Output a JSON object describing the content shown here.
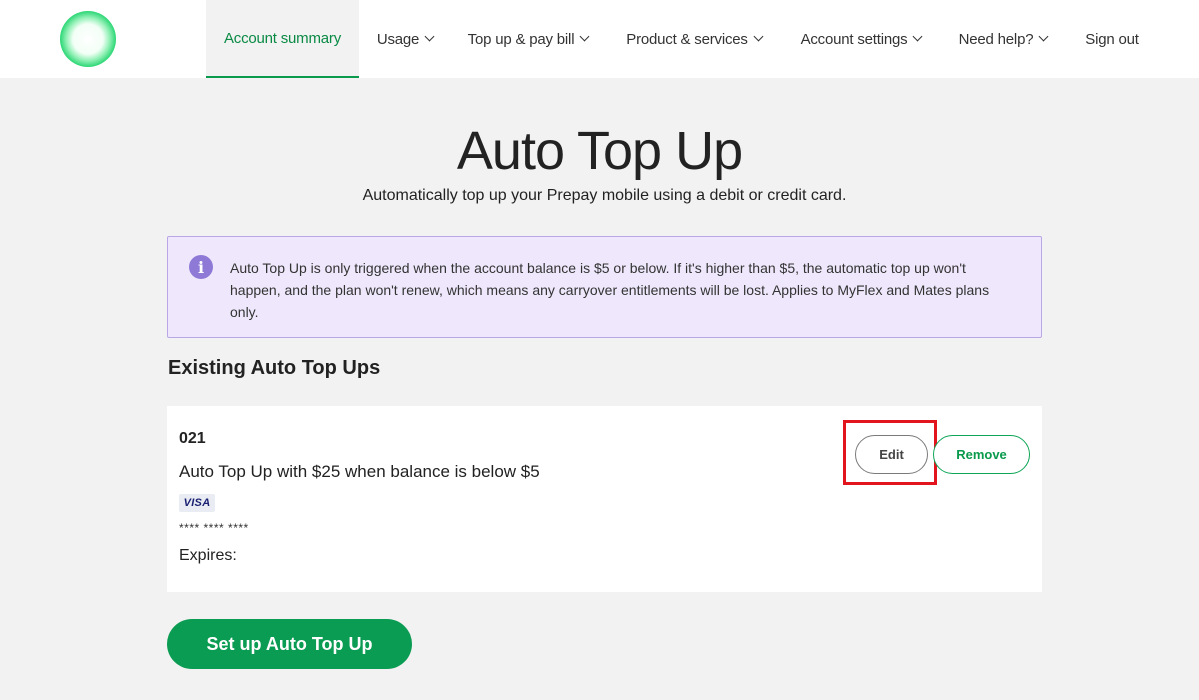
{
  "nav": {
    "account_summary": "Account summary",
    "usage": "Usage",
    "top_up": "Top up & pay bill",
    "products": "Product & services",
    "account_settings": "Account settings",
    "need_help": "Need help?",
    "sign_out": "Sign out"
  },
  "page": {
    "title": "Auto Top Up",
    "subtitle": "Automatically top up your Prepay mobile using a debit or credit card."
  },
  "info": {
    "icon": "info-icon",
    "text": "Auto Top Up is only triggered when the account balance is $5 or below. If it's higher than $5, the automatic top up won't happen, and the plan won't renew, which means any carryover entitlements will be lost. Applies to MyFlex and Mates plans only."
  },
  "existing": {
    "heading": "Existing Auto Top Ups",
    "item": {
      "number": "021",
      "description": "Auto Top Up with $25 when balance is below $5",
      "card_brand": "VISA",
      "masked_card": "**** **** ****",
      "expires_label": "Expires:",
      "edit_label": "Edit",
      "remove_label": "Remove"
    }
  },
  "setup_button": "Set up Auto Top Up",
  "colors": {
    "brand_green": "#0a9c52",
    "highlight_red": "#e2141d",
    "info_bg": "#efe8fc",
    "info_icon": "#8e7ad6"
  }
}
